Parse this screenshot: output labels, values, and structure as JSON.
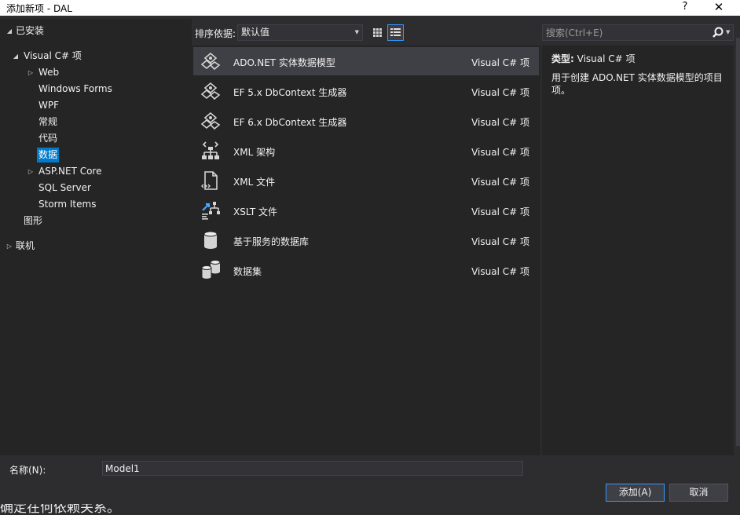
{
  "window": {
    "title": "添加新项 - DAL",
    "help_glyph": "?",
    "close_glyph": "✕"
  },
  "tree": {
    "installed": "已安装",
    "visual_csharp": "Visual C# 项",
    "web": "Web",
    "windows_forms": "Windows Forms",
    "wpf": "WPF",
    "general": "常规",
    "code": "代码",
    "data": "数据",
    "aspnet_core": "ASP.NET Core",
    "sql_server": "SQL Server",
    "storm_items": "Storm Items",
    "graphics": "图形",
    "online": "联机"
  },
  "toolbar": {
    "sort_label": "排序依据:",
    "sort_value": "默认值"
  },
  "search": {
    "placeholder": "搜索(Ctrl+E)"
  },
  "items": [
    {
      "name": "ADO.NET 实体数据模型",
      "category": "Visual C# 项",
      "icon": "ado-net-entity-model-icon"
    },
    {
      "name": "EF 5.x DbContext 生成器",
      "category": "Visual C# 项",
      "icon": "ef-dbcontext-generator-icon"
    },
    {
      "name": "EF 6.x DbContext 生成器",
      "category": "Visual C# 项",
      "icon": "ef-dbcontext-generator-icon"
    },
    {
      "name": "XML 架构",
      "category": "Visual C# 项",
      "icon": "xml-schema-icon"
    },
    {
      "name": "XML 文件",
      "category": "Visual C# 项",
      "icon": "xml-file-icon"
    },
    {
      "name": "XSLT 文件",
      "category": "Visual C# 项",
      "icon": "xslt-file-icon"
    },
    {
      "name": "基于服务的数据库",
      "category": "Visual C# 项",
      "icon": "service-database-icon"
    },
    {
      "name": "数据集",
      "category": "Visual C# 项",
      "icon": "dataset-icon"
    }
  ],
  "details": {
    "type_label": "类型:",
    "type_value": "Visual C# 项",
    "description": "用于创建 ADO.NET 实体数据模型的项目项。"
  },
  "footer": {
    "name_label": "名称(N):",
    "name_value": "Model1",
    "add_button": "添加(A)",
    "cancel_button": "取消",
    "background_text": "确定在何依赖关系。"
  },
  "colors": {
    "accent": "#007acc",
    "background": "#2d2d30",
    "panel": "#252526"
  }
}
